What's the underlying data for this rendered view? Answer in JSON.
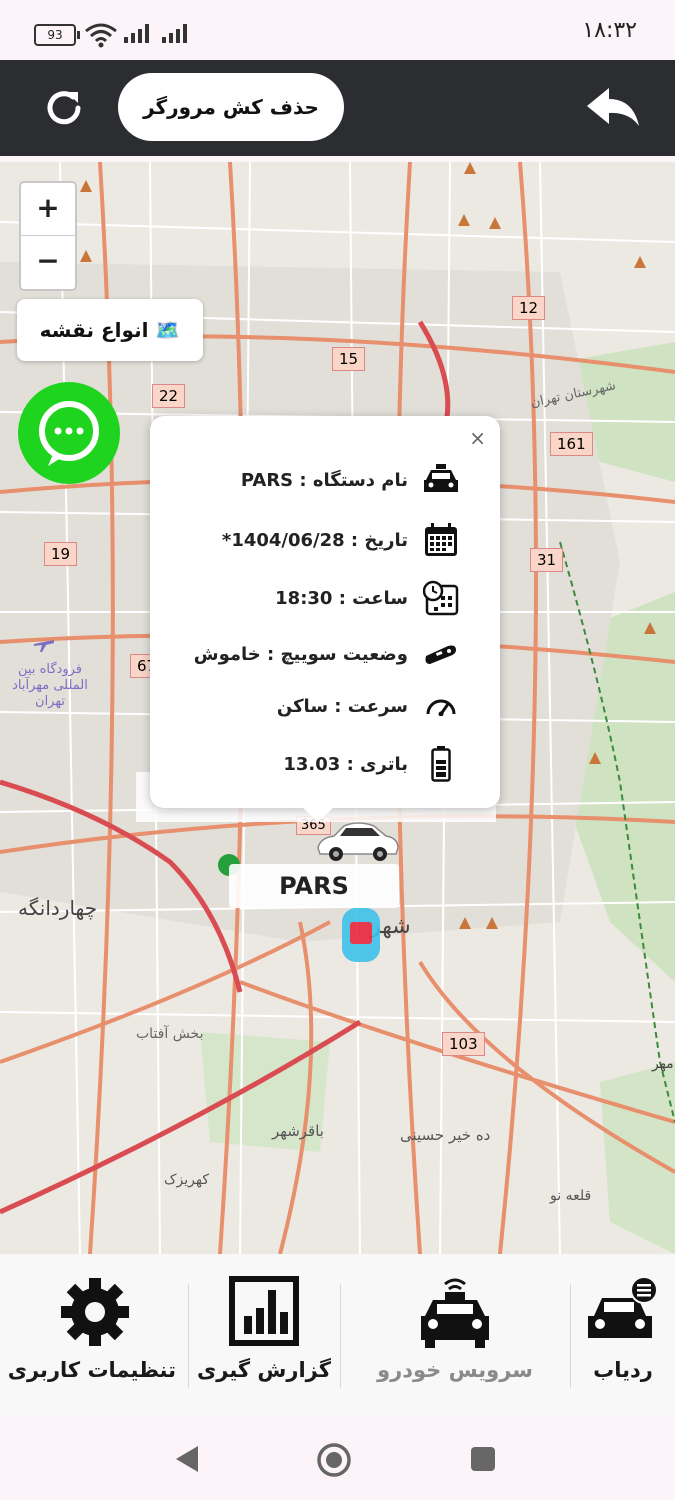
{
  "status_bar": {
    "time": "۱۸:۳۲",
    "battery": "93"
  },
  "toolbar": {
    "clear_cache_label": "حذف کش مرورگر"
  },
  "map": {
    "zoom_in": "+",
    "zoom_out": "−",
    "map_types_label": "🗺️ انواع نقشه",
    "vehicle_label": "PARS",
    "roads": [
      {
        "label": "12"
      },
      {
        "label": "15"
      },
      {
        "label": "22"
      },
      {
        "label": "161"
      },
      {
        "label": "19"
      },
      {
        "label": "31"
      },
      {
        "label": "67"
      },
      {
        "label": "103"
      },
      {
        "label": "365"
      }
    ],
    "places": [
      {
        "label": "شهرستان تهران"
      },
      {
        "label": "فرودگاه بین المللی مهرآباد تهران"
      },
      {
        "label": "چهاردانگه"
      },
      {
        "label": "بخش آفتاب"
      },
      {
        "label": "باقرشهر"
      },
      {
        "label": "ده خیر حسینی"
      },
      {
        "label": "کهریزک"
      },
      {
        "label": "قلعه نو"
      },
      {
        "label": "شهر"
      },
      {
        "label": "مهر"
      }
    ]
  },
  "popup": {
    "close": "×",
    "rows": [
      {
        "icon": "taxi-icon",
        "text": "نام دستگاه : PARS"
      },
      {
        "icon": "calendar-icon",
        "text": "تاریخ : 1404/06/28*"
      },
      {
        "icon": "clock-calendar-icon",
        "text": "ساعت : 18:30"
      },
      {
        "icon": "car-key-icon",
        "text": "وضعیت سوییچ : خاموش"
      },
      {
        "icon": "speedometer-icon",
        "text": "سرعت : ساکن"
      },
      {
        "icon": "battery-icon",
        "text": "باتری : 13.03"
      }
    ]
  },
  "bottom_nav": {
    "settings": "تنظیمات کاربری",
    "reports": "گزارش گیری",
    "car_service": "سرویس خودرو",
    "tracker": "ردیاب"
  },
  "colors": {
    "topbar": "#2b2d31",
    "chat": "#1fd41f",
    "road": "#e88f6d",
    "highway": "#d94d52"
  }
}
